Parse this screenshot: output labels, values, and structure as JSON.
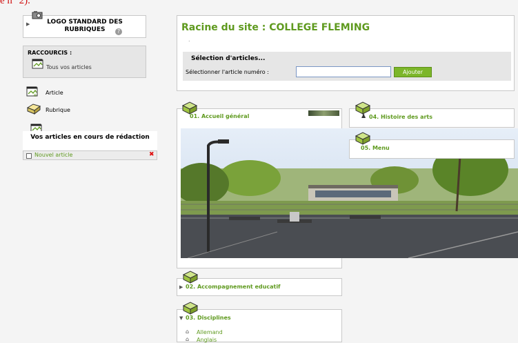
{
  "page": {
    "top_text": "e n° 2)."
  },
  "sidebar": {
    "logo_box": {
      "label": "LOGO STANDARD DES RUBRIQUES",
      "help_glyph": "?"
    },
    "shortcuts": {
      "title": "RACCOURCIS :",
      "all_articles": "Tous vos articles"
    },
    "actions": [
      {
        "label": "Article"
      },
      {
        "label": "Rubrique"
      }
    ],
    "drafts": {
      "title": "Vos articles en cours de rédaction",
      "items": [
        {
          "label": "Nouvel article"
        }
      ]
    }
  },
  "main": {
    "site_title": "Racine du site : COLLEGE FLEMING",
    "dot": ".",
    "selection": {
      "title": "Sélection d'articles...",
      "label": "Sélectionner l'article numéro :",
      "input_value": "",
      "button": "Ajouter"
    },
    "sections": [
      {
        "label": "01. Accueil général"
      },
      {
        "label": "04. Histoire des arts"
      },
      {
        "label": "05. Menu"
      },
      {
        "label": "02. Accompagnement educatif"
      },
      {
        "label": "03. Disciplines",
        "children": [
          {
            "label": "Allemand"
          },
          {
            "label": "Anglais"
          }
        ]
      }
    ]
  },
  "colors": {
    "accent_green": "#5f9a1f",
    "button_green": "#7cb62a",
    "delete_red": "#e01010"
  }
}
